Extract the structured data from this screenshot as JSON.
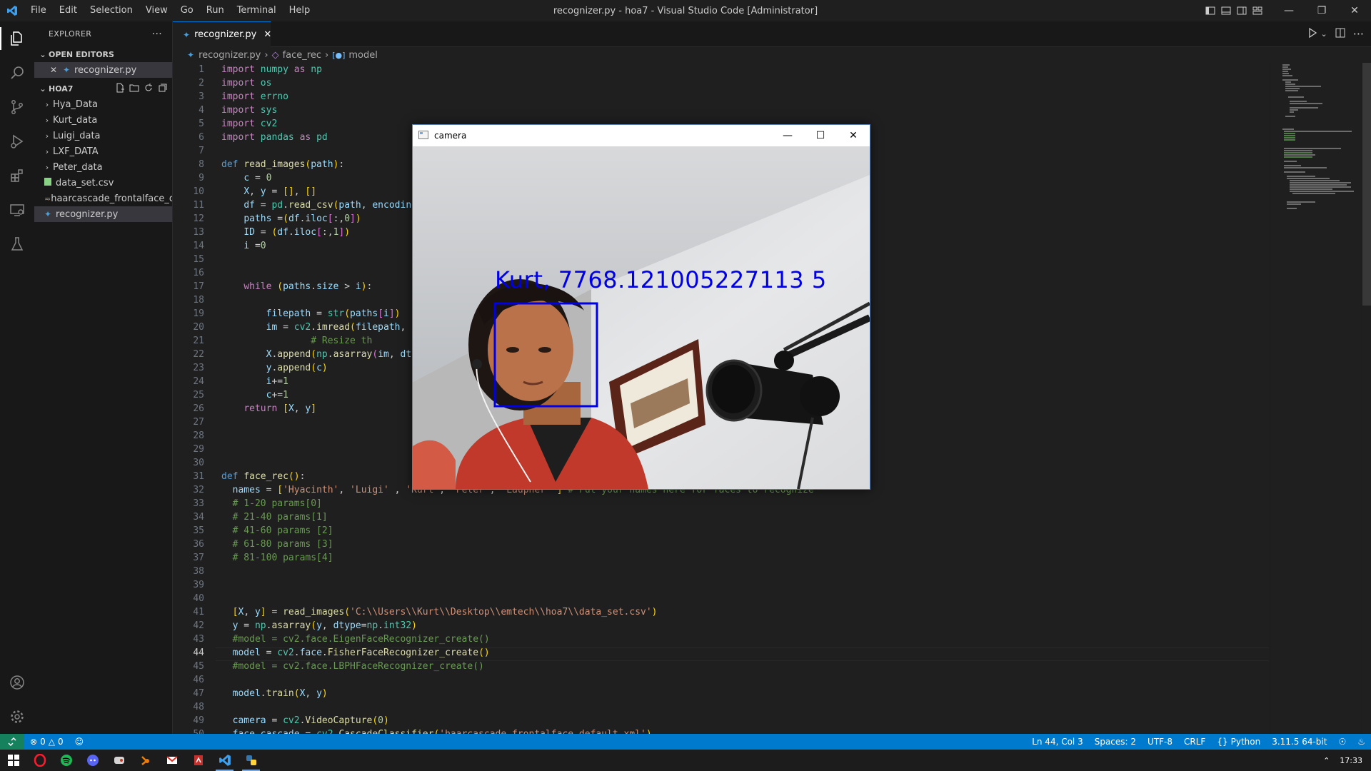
{
  "window": {
    "title": "recognizer.py - hoa7 - Visual Studio Code [Administrator]",
    "menu": [
      "File",
      "Edit",
      "Selection",
      "View",
      "Go",
      "Run",
      "Terminal",
      "Help"
    ]
  },
  "sidebar": {
    "header": "EXPLORER",
    "open_editors_label": "OPEN EDITORS",
    "open_editor_file": "recognizer.py",
    "folder_label": "HOA7",
    "items": [
      {
        "label": "Hya_Data",
        "type": "folder"
      },
      {
        "label": "Kurt_data",
        "type": "folder"
      },
      {
        "label": "Luigi_data",
        "type": "folder"
      },
      {
        "label": "LXF_DATA",
        "type": "folder"
      },
      {
        "label": "Peter_data",
        "type": "folder"
      },
      {
        "label": "data_set.csv",
        "type": "csv"
      },
      {
        "label": "haarcascade_frontalface_d...",
        "type": "xml"
      },
      {
        "label": "recognizer.py",
        "type": "python",
        "selected": true
      }
    ]
  },
  "editor": {
    "tab_label": "recognizer.py",
    "breadcrumb": [
      "recognizer.py",
      "face_rec",
      "model"
    ],
    "current_line": 44
  },
  "camera_window": {
    "title": "camera",
    "overlay_text": "Kurt, 7768.121005227113 5"
  },
  "statusbar": {
    "errors": "0",
    "warnings": "0",
    "position": "Ln 44, Col 3",
    "spaces": "Spaces: 2",
    "encoding": "UTF-8",
    "eol": "CRLF",
    "language": "Python",
    "interpreter": "3.11.5 64-bit"
  },
  "taskbar": {
    "time": "17:33"
  },
  "colors": {
    "accent": "#007acc",
    "remote": "#16825d",
    "face_box": "#0000e6"
  }
}
